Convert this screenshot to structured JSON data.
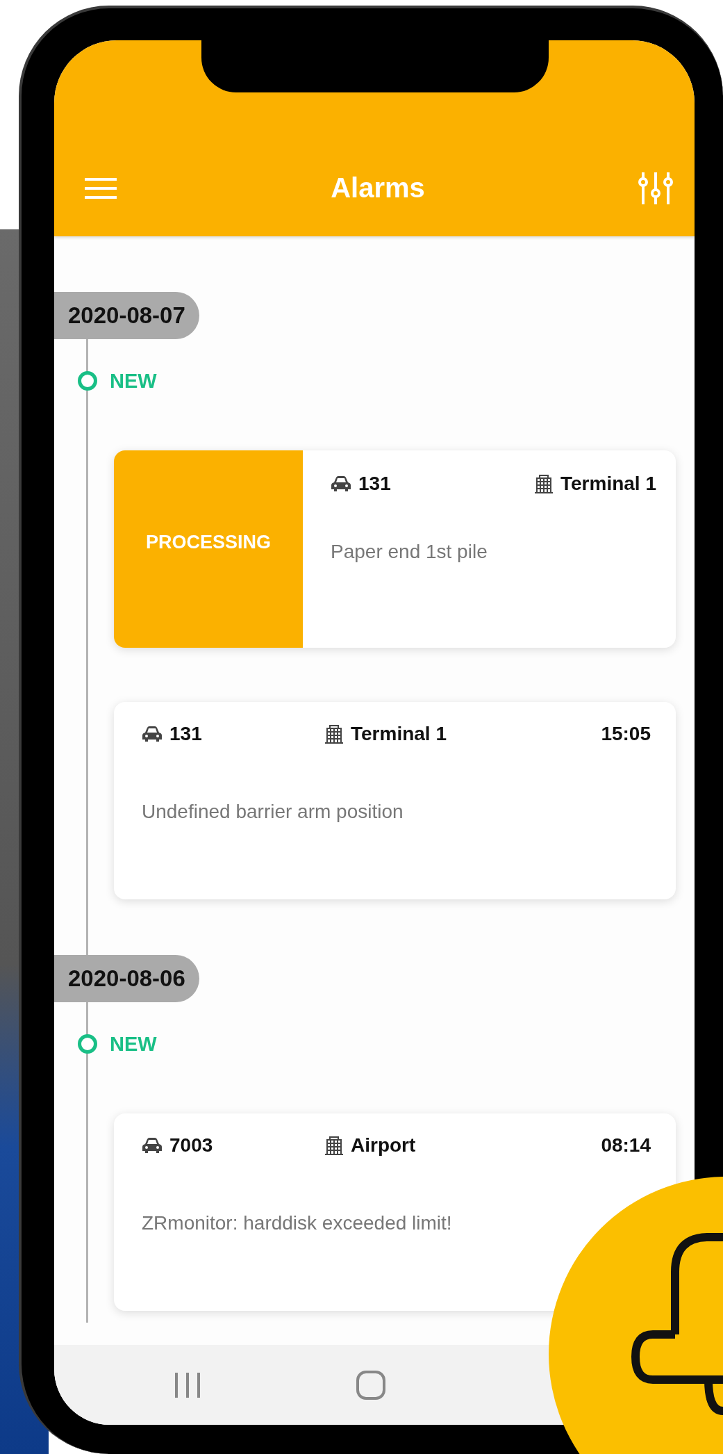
{
  "app_bar": {
    "title": "Alarms"
  },
  "groups": [
    {
      "date": "2020-08-07",
      "status": "NEW",
      "alarms": [
        {
          "kind": "processing",
          "badge": "PROCESSING",
          "vehicle": "131",
          "location": "Terminal 1",
          "message": "Paper end 1st pile"
        },
        {
          "kind": "timed",
          "vehicle": "131",
          "location": "Terminal 1",
          "time": "15:05",
          "message": "Undefined barrier arm position"
        }
      ]
    },
    {
      "date": "2020-08-06",
      "status": "NEW",
      "alarms": [
        {
          "kind": "timed",
          "vehicle": "7003",
          "location": "Airport",
          "time": "08:14",
          "message": "ZRmonitor: harddisk exceeded limit!"
        }
      ]
    }
  ]
}
